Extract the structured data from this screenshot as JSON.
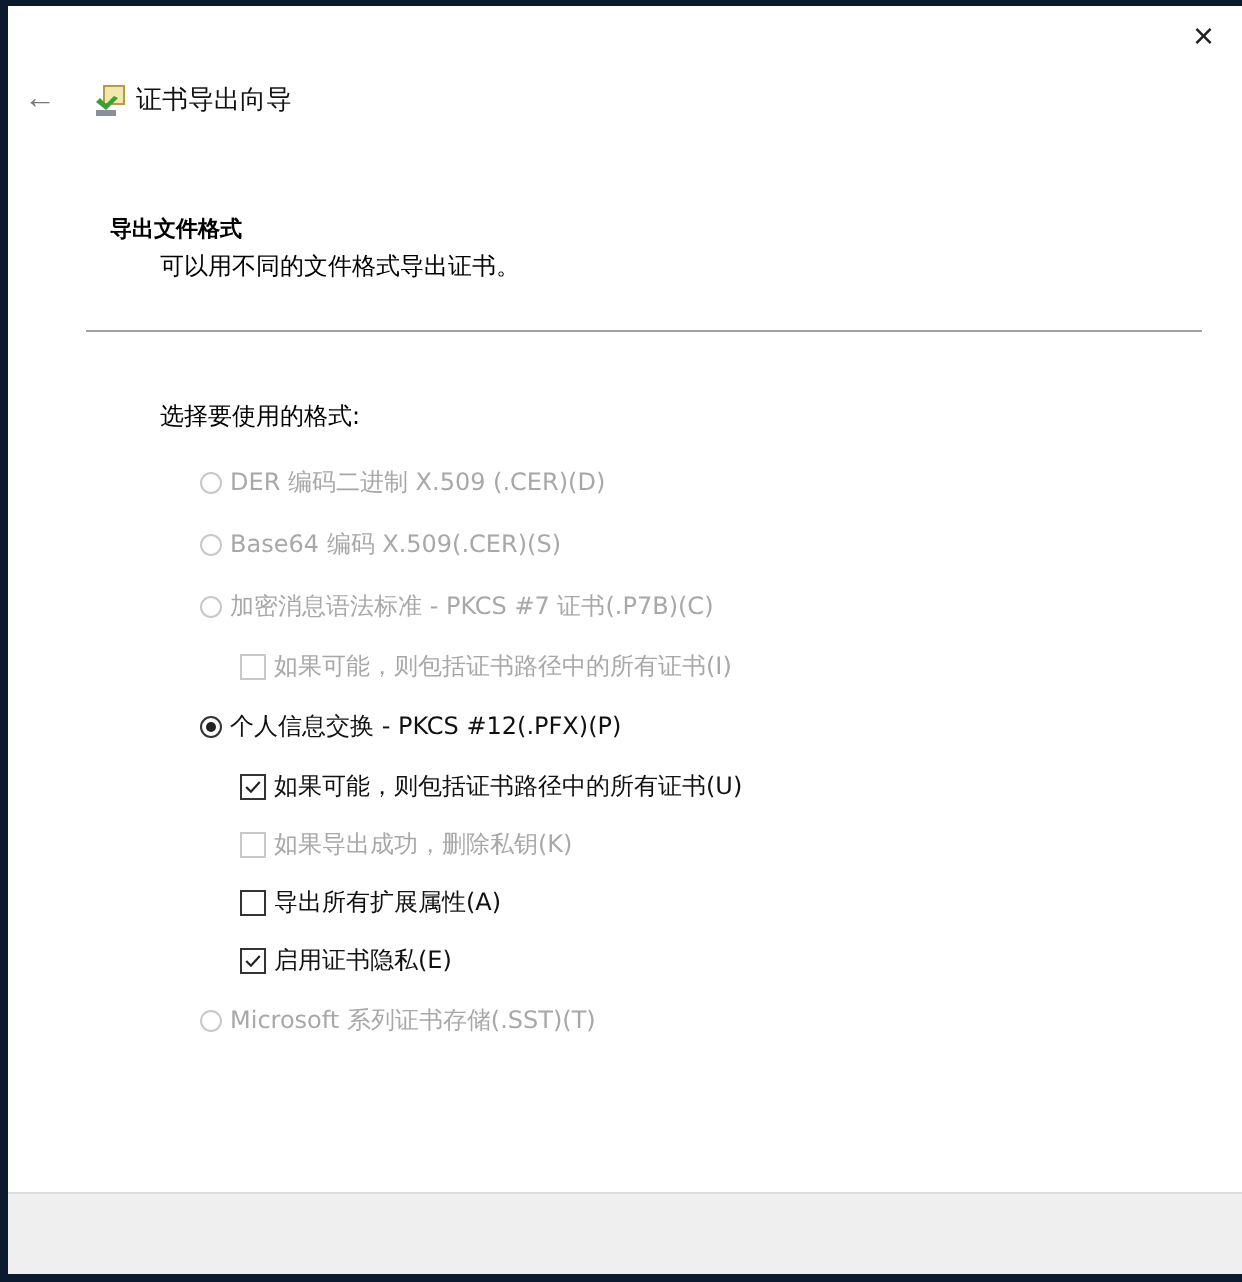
{
  "window": {
    "title": "证书导出向导",
    "close": "×",
    "back": "←"
  },
  "section": {
    "heading": "导出文件格式",
    "description": "可以用不同的文件格式导出证书。"
  },
  "prompt": "选择要使用的格式:",
  "options": [
    {
      "kind": "radio",
      "label": "DER 编码二进制 X.509 (.CER)(D)",
      "selected": false,
      "disabled": true
    },
    {
      "kind": "radio",
      "label": "Base64 编码 X.509(.CER)(S)",
      "selected": false,
      "disabled": true
    },
    {
      "kind": "radio",
      "label": "加密消息语法标准 - PKCS #7 证书(.P7B)(C)",
      "selected": false,
      "disabled": true,
      "children": [
        {
          "kind": "checkbox",
          "label": "如果可能，则包括证书路径中的所有证书(I)",
          "checked": false,
          "disabled": true
        }
      ]
    },
    {
      "kind": "radio",
      "label": "个人信息交换 - PKCS #12(.PFX)(P)",
      "selected": true,
      "disabled": false,
      "children": [
        {
          "kind": "checkbox",
          "label": "如果可能，则包括证书路径中的所有证书(U)",
          "checked": true,
          "disabled": false
        },
        {
          "kind": "checkbox",
          "label": "如果导出成功，删除私钥(K)",
          "checked": false,
          "disabled": true
        },
        {
          "kind": "checkbox",
          "label": "导出所有扩展属性(A)",
          "checked": false,
          "disabled": false
        },
        {
          "kind": "checkbox",
          "label": "启用证书隐私(E)",
          "checked": true,
          "disabled": false
        }
      ]
    },
    {
      "kind": "radio",
      "label": "Microsoft 系列证书存储(.SST)(T)",
      "selected": false,
      "disabled": true
    }
  ]
}
